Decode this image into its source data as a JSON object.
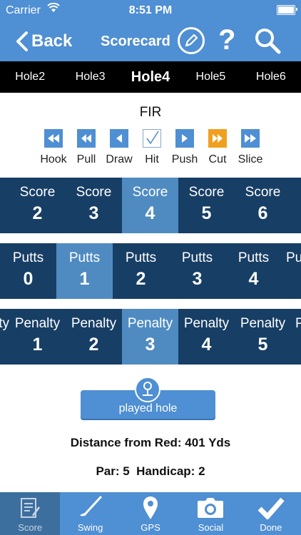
{
  "status": {
    "carrier": "Carrier",
    "time": "8:51 PM"
  },
  "nav": {
    "back_label": "Back",
    "title": "Scorecard"
  },
  "holes": [
    "Hole2",
    "Hole3",
    "Hole4",
    "Hole5",
    "Hole6"
  ],
  "holes_active_index": 2,
  "fir": {
    "title": "FIR",
    "options": [
      {
        "label": "Hook",
        "icon": "double-left-icon"
      },
      {
        "label": "Pull",
        "icon": "rewind-icon"
      },
      {
        "label": "Draw",
        "icon": "left-arrow-icon"
      },
      {
        "label": "Hit",
        "icon": "checkmark-icon"
      },
      {
        "label": "Push",
        "icon": "right-arrow-icon"
      },
      {
        "label": "Cut",
        "icon": "fast-forward-icon"
      },
      {
        "label": "Slice",
        "icon": "double-right-icon"
      }
    ],
    "selected": [
      "Hit",
      "Cut"
    ]
  },
  "score": {
    "label": "Score",
    "values": [
      "2",
      "3",
      "4",
      "5",
      "6"
    ],
    "selected": "4"
  },
  "putts": {
    "label": "Putts",
    "values": [
      "0",
      "1",
      "2",
      "3",
      "4"
    ],
    "selected": "1"
  },
  "penalty": {
    "label": "Penalty",
    "values": [
      "1",
      "2",
      "3",
      "4",
      "5"
    ],
    "selected": "3"
  },
  "played_button": "played hole",
  "distance_text": "Distance from Red: 401 Yds",
  "par_text": "Par: 5  Handicap: 2",
  "tabs": [
    {
      "label": "Score",
      "icon": "scorecard-icon"
    },
    {
      "label": "Swing",
      "icon": "golf-club-icon"
    },
    {
      "label": "GPS",
      "icon": "map-pin-icon"
    },
    {
      "label": "Social",
      "icon": "camera-icon"
    },
    {
      "label": "Done",
      "icon": "checkmark-icon"
    }
  ],
  "tabs_active_index": 0,
  "colors": {
    "primary": "#4f8fd3",
    "dark": "#173e65",
    "selected": "#4f8bc1",
    "accent": "#f0a020"
  }
}
